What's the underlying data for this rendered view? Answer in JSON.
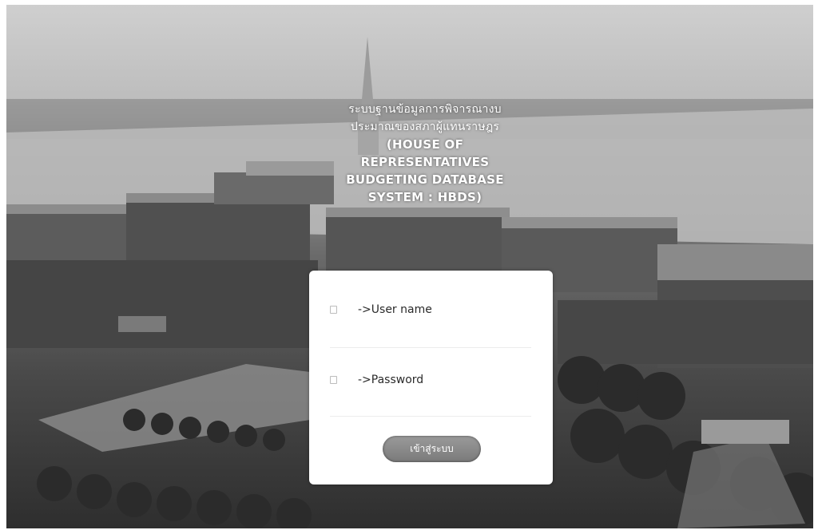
{
  "header": {
    "title_thai_line1": "ระบบฐานข้อมูลการพิจารณางบ",
    "title_thai_line2": "ประมาณของสภาผู้แทนราษฎร",
    "title_en_line1": "(HOUSE OF",
    "title_en_line2": "REPRESENTATIVES",
    "title_en_line3": "BUDGETING DATABASE",
    "title_en_line4": "SYSTEM : HBDS)"
  },
  "login": {
    "username_placeholder": "->User name",
    "password_placeholder": "->Password",
    "submit_label": "เข้าสู่ระบบ",
    "username_icon": "user-icon",
    "password_icon": "lock-icon"
  }
}
